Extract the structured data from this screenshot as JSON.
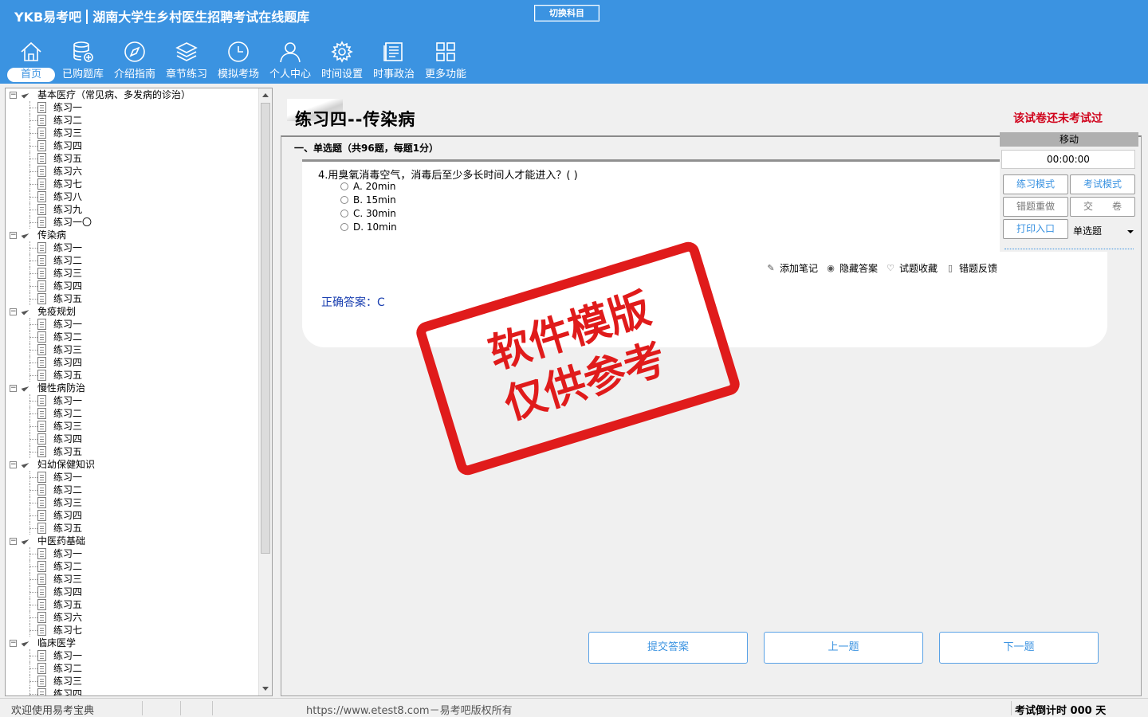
{
  "header": {
    "brand_logo": "YKB易考吧",
    "app_title": "湖南大学生乡村医生招聘考试在线题库",
    "switch_label": "切换科目",
    "toolbar": [
      {
        "label": "首页",
        "icon": "home-icon"
      },
      {
        "label": "已购题库",
        "icon": "database-icon"
      },
      {
        "label": "介绍指南",
        "icon": "compass-icon"
      },
      {
        "label": "章节练习",
        "icon": "layers-icon"
      },
      {
        "label": "模拟考场",
        "icon": "clock-icon"
      },
      {
        "label": "个人中心",
        "icon": "user-icon"
      },
      {
        "label": "时间设置",
        "icon": "gear-icon"
      },
      {
        "label": "时事政治",
        "icon": "news-icon"
      },
      {
        "label": "更多功能",
        "icon": "grid-icon"
      }
    ]
  },
  "tree": [
    {
      "category": "基本医疗（常见病、多发病的诊治）",
      "items": [
        "练习一",
        "练习二",
        "练习三",
        "练习四",
        "练习五",
        "练习六",
        "练习七",
        "练习八",
        "练习九",
        "练习一〇"
      ]
    },
    {
      "category": "传染病",
      "items": [
        "练习一",
        "练习二",
        "练习三",
        "练习四",
        "练习五"
      ]
    },
    {
      "category": "免疫规划",
      "items": [
        "练习一",
        "练习二",
        "练习三",
        "练习四",
        "练习五"
      ]
    },
    {
      "category": "慢性病防治",
      "items": [
        "练习一",
        "练习二",
        "练习三",
        "练习四",
        "练习五"
      ]
    },
    {
      "category": "妇幼保健知识",
      "items": [
        "练习一",
        "练习二",
        "练习三",
        "练习四",
        "练习五"
      ]
    },
    {
      "category": "中医药基础",
      "items": [
        "练习一",
        "练习二",
        "练习三",
        "练习四",
        "练习五",
        "练习六",
        "练习七"
      ]
    },
    {
      "category": "临床医学",
      "items": [
        "练习一",
        "练习二",
        "练习三",
        "练习四"
      ]
    }
  ],
  "main": {
    "paper_title": "练习四--传染病",
    "exam_status": "该试卷还未考试过",
    "section_title": "一、单选题（共96题，每题1分）",
    "question": "4.用臭氧消毒空气，消毒后至少多长时间人才能进入？( )",
    "options": [
      "A. 20min",
      "B. 15min",
      "C. 30min",
      "D. 10min"
    ],
    "actions": [
      {
        "label": "添加笔记",
        "icon": "pencil-icon"
      },
      {
        "label": "隐藏答案",
        "icon": "eye-icon"
      },
      {
        "label": "试题收藏",
        "icon": "heart-icon"
      },
      {
        "label": "错题反馈",
        "icon": "feedback-icon"
      }
    ],
    "answer_label": "正确答案：",
    "answer_value": "C"
  },
  "control": {
    "move_label": "移动",
    "timer": "00:00:00",
    "practice_mode": "练习模式",
    "exam_mode": "考试模式",
    "redo_wrong": "错题重做",
    "submit_paper": "交　　卷",
    "print_entry": "打印入口",
    "question_type": "单选题"
  },
  "nav": {
    "submit_answer": "提交答案",
    "prev": "上一题",
    "next": "下一题"
  },
  "stamp": {
    "line1": "软件模版",
    "line2": "仅供参考"
  },
  "status": {
    "welcome": "欢迎使用易考宝典",
    "url": "https://www.etest8.com－易考吧版权所有",
    "countdown_label": "考试倒计时",
    "countdown_value": "000 天"
  },
  "colors": {
    "header_bg": "#3b93e1",
    "accent": "#3b93e1",
    "alert_red": "#d0021b",
    "stamp_red": "#e01b1b",
    "answer_blue": "#1a3fb0"
  }
}
